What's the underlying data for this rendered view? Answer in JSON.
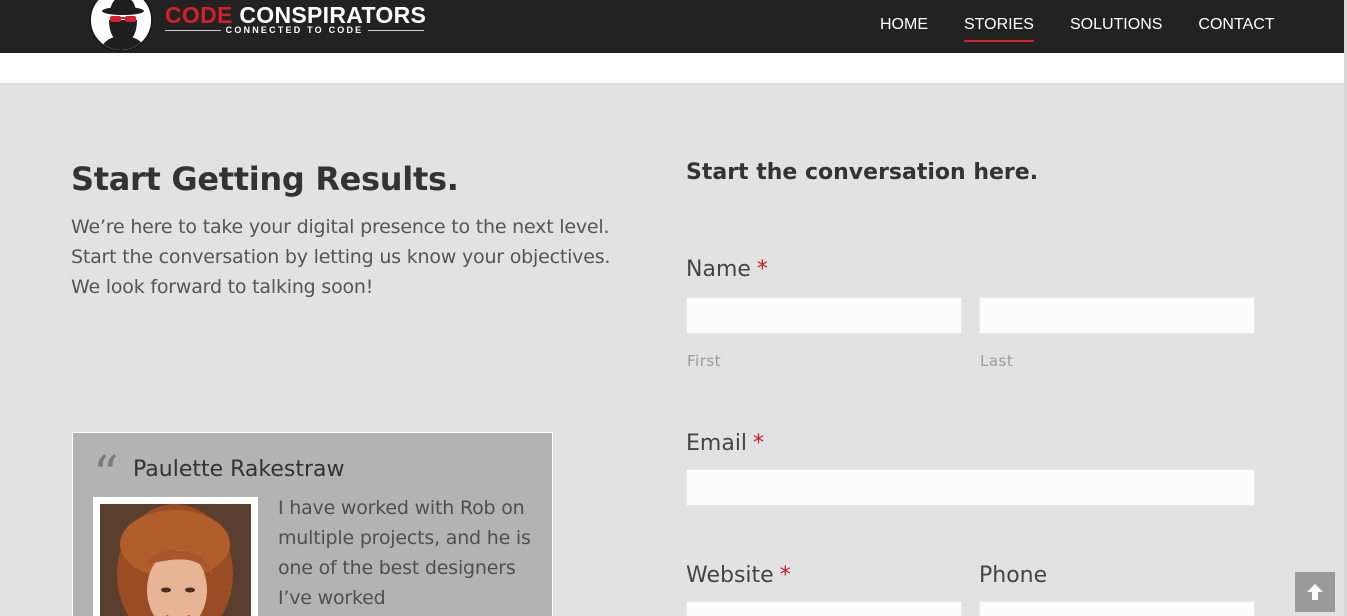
{
  "brand": {
    "name_red": "CODE",
    "name_white": "CONSPIRATORS",
    "tagline": "CONNECTED TO CODE",
    "logo_icon": "spy-with-glasses-icon",
    "colors": {
      "accent": "#d3202a",
      "header_bg": "#222222",
      "page_bg": "#e2e2e2"
    }
  },
  "nav": {
    "items": [
      {
        "label": "HOME"
      },
      {
        "label": "STORIES"
      },
      {
        "label": "SOLUTIONS"
      },
      {
        "label": "CONTACT"
      }
    ],
    "active": "STORIES"
  },
  "intro": {
    "title": "Start Getting Results.",
    "body": "We’re here to take your digital presence to the next level. Start the conversation by letting us know your objectives. We look forward to talking soon!"
  },
  "testimonial": {
    "quote_icon": "quote-icon",
    "name": "Paulette Rakestraw",
    "text": "I have worked with Rob on multiple projects, and he is one of the best designers I’ve worked"
  },
  "form": {
    "heading": "Start the conversation here.",
    "name_label": "Name",
    "required_mark": "*",
    "first_value": "",
    "first_sublabel": "First",
    "last_value": "",
    "last_sublabel": "Last",
    "email_label": "Email",
    "email_value": "",
    "website_label": "Website",
    "website_value": "",
    "phone_label": "Phone",
    "phone_value": ""
  },
  "scroll_top_icon": "arrow-up-icon"
}
